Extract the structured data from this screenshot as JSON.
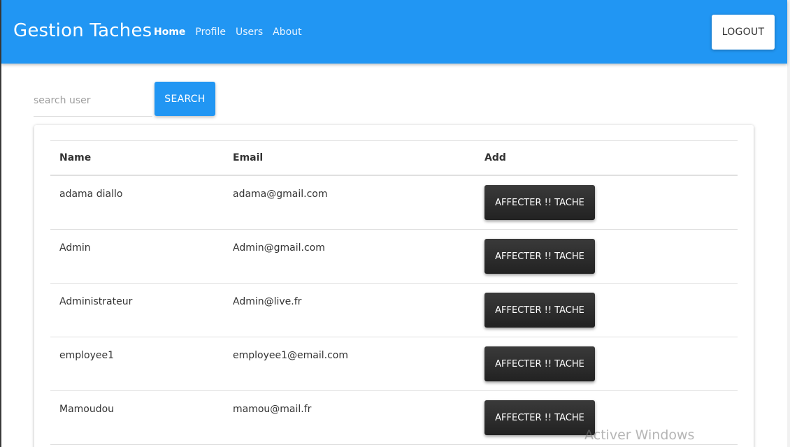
{
  "navbar": {
    "brand": "Gestion Taches",
    "links": [
      {
        "label": "Home",
        "active": true
      },
      {
        "label": "Profile",
        "active": false
      },
      {
        "label": "Users",
        "active": false
      },
      {
        "label": "About",
        "active": false
      }
    ],
    "logout_label": "LOGOUT",
    "color": "#2196f3"
  },
  "search": {
    "placeholder": "search user",
    "value": "",
    "button_label": "SEARCH"
  },
  "table": {
    "headers": {
      "name": "Name",
      "email": "Email",
      "add": "Add"
    },
    "rows": [
      {
        "name": "adama diallo",
        "email": "adama@gmail.com",
        "action": "AFFECTER !! TACHE"
      },
      {
        "name": "Admin",
        "email": "Admin@gmail.com",
        "action": "AFFECTER !! TACHE"
      },
      {
        "name": "Administrateur",
        "email": "Admin@live.fr",
        "action": "AFFECTER !! TACHE"
      },
      {
        "name": "employee1",
        "email": "employee1@email.com",
        "action": "AFFECTER !! TACHE"
      },
      {
        "name": "Mamoudou",
        "email": "mamou@mail.fr",
        "action": "AFFECTER !! TACHE"
      }
    ]
  },
  "watermark": "Activer Windows"
}
